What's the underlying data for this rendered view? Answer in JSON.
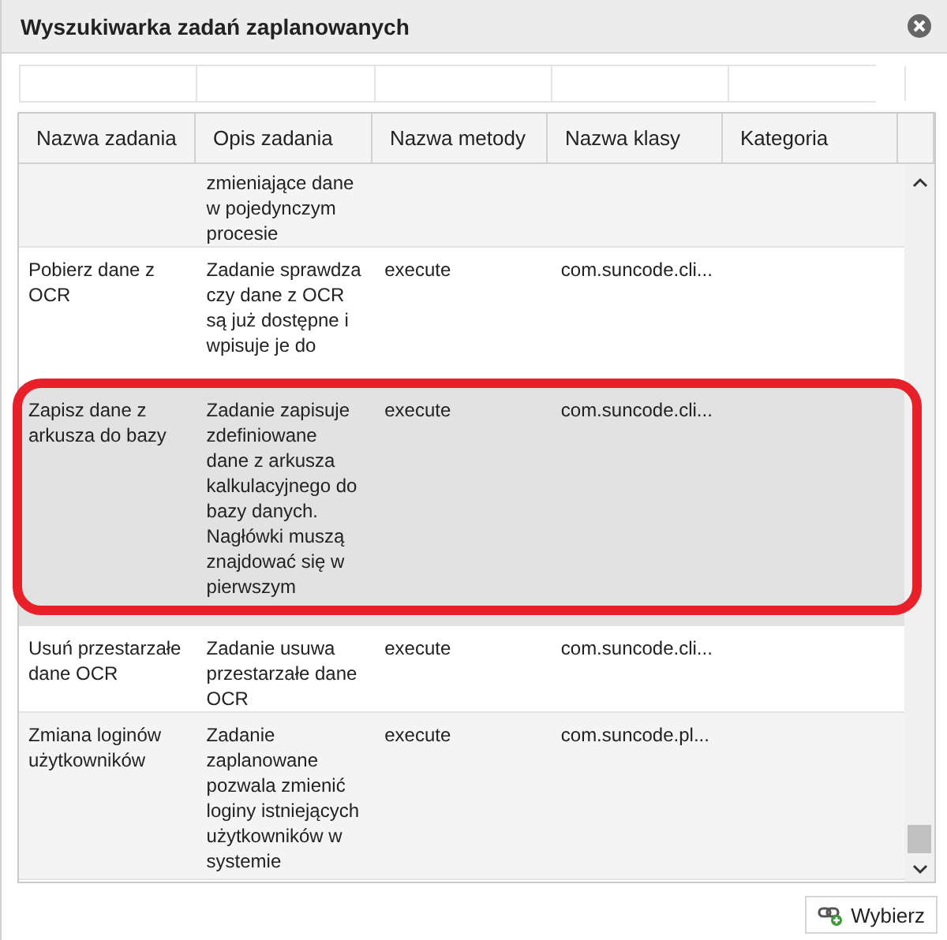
{
  "dialog": {
    "title": "Wyszukiwarka zadań zaplanowanych"
  },
  "columns": [
    "Nazwa zadania",
    "Opis zadania",
    "Nazwa metody",
    "Nazwa klasy",
    "Kategoria"
  ],
  "rows": [
    {
      "cells": [
        "",
        "zmieniające dane w pojedynczym procesie",
        "",
        "",
        ""
      ],
      "selected": false,
      "outlined": false
    },
    {
      "cells": [
        "Pobierz dane z OCR",
        "Zadanie sprawdza czy dane z OCR są już dostępne i wpisuje je do",
        "execute",
        "com.suncode.cli...",
        ""
      ],
      "selected": false,
      "outlined": false
    },
    {
      "cells": [
        "Zapisz dane z arkusza do bazy",
        "Zadanie zapisuje zdefiniowane dane z arkusza kalkulacyjnego do bazy danych. Nagłówki muszą znajdować się w pierwszym",
        "execute",
        "com.suncode.cli...",
        ""
      ],
      "selected": true,
      "outlined": true
    },
    {
      "cells": [
        "Usuń przestarzałe dane OCR",
        "Zadanie usuwa przestarzałe dane OCR",
        "execute",
        "com.suncode.cli...",
        ""
      ],
      "selected": false,
      "outlined": false
    },
    {
      "cells": [
        "Zmiana loginów użytkowników",
        "Zadanie zaplanowane pozwala zmienić loginy istniejących użytkowników w systemie",
        "execute",
        "com.suncode.pl...",
        ""
      ],
      "selected": false,
      "outlined": false
    }
  ],
  "button": {
    "label": "Wybierz"
  }
}
